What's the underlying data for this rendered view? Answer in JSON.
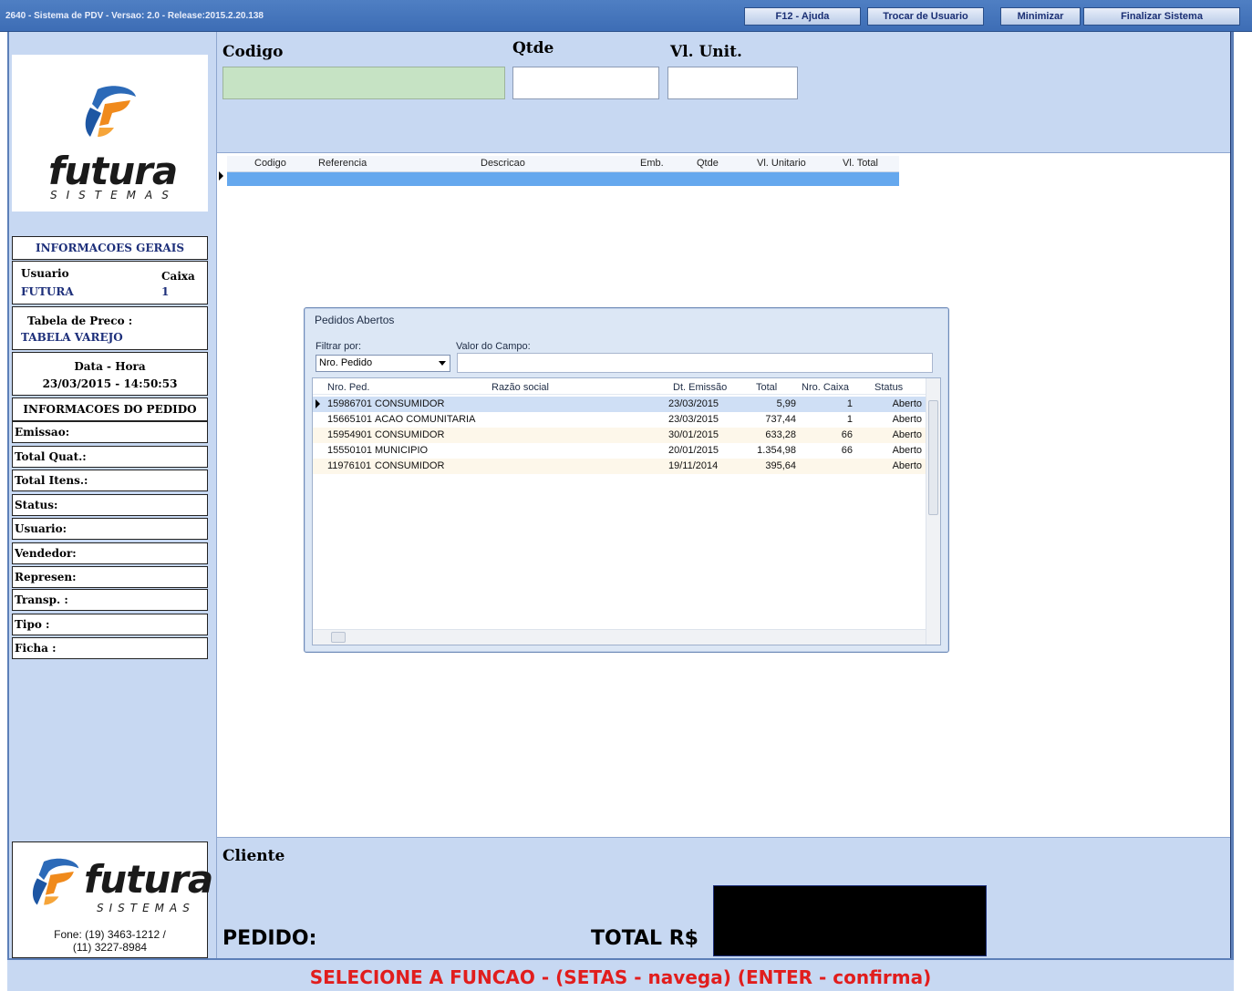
{
  "window": {
    "title": "2640 - Sistema de PDV - Versao: 2.0 - Release:2015.2.20.138",
    "buttons": {
      "help": "F12 - Ajuda",
      "switch_user": "Trocar de Usuario",
      "minimize": "Minimizar",
      "exit": "Finalizar Sistema"
    }
  },
  "brand": {
    "name": "futura",
    "sub": "SISTEMAS"
  },
  "info": {
    "header": "INFORMACOES GERAIS",
    "user_label": "Usuario",
    "user_value": "FUTURA",
    "caixa_label": "Caixa",
    "caixa_value": "1",
    "price_table_label": "Tabela de Preco :",
    "price_table_value": "TABELA VAREJO",
    "datetime_label": "Data - Hora",
    "datetime_value": "23/03/2015 - 14:50:53",
    "order_header": "INFORMACOES DO PEDIDO",
    "fields": [
      "Emissao:",
      "Total Quat.:",
      "Total Itens.:",
      "Status:",
      "Usuario:",
      "Vendedor:",
      "Represen:",
      "Transp. :",
      "Tipo :",
      "Ficha :"
    ]
  },
  "entry": {
    "codigo_label": "Codigo",
    "qtde_label": "Qtde",
    "vlunit_label": "Vl. Unit."
  },
  "grid": {
    "columns": [
      "Codigo",
      "Referencia",
      "Descricao",
      "Emb.",
      "Qtde",
      "Vl. Unitario",
      "Vl. Total"
    ]
  },
  "dialog": {
    "title": "Pedidos Abertos",
    "filter_label": "Filtrar por:",
    "filter_value": "Nro. Pedido",
    "field_value_label": "Valor do Campo:",
    "columns": [
      "Nro. Ped.",
      "Razão social",
      "Dt. Emissão",
      "Total",
      "Nro. Caixa",
      "Status"
    ],
    "rows": [
      {
        "nro": "15986701",
        "razao": "CONSUMIDOR",
        "data": "23/03/2015",
        "total": "5,99",
        "caixa": "1",
        "status": "Aberto"
      },
      {
        "nro": "15665101",
        "razao": "ACAO COMUNITARIA",
        "data": "23/03/2015",
        "total": "737,44",
        "caixa": "1",
        "status": "Aberto"
      },
      {
        "nro": "15954901",
        "razao": "CONSUMIDOR",
        "data": "30/01/2015",
        "total": "633,28",
        "caixa": "66",
        "status": "Aberto"
      },
      {
        "nro": "15550101",
        "razao": "MUNICIPIO",
        "data": "20/01/2015",
        "total": "1.354,98",
        "caixa": "66",
        "status": "Aberto"
      },
      {
        "nro": "11976101",
        "razao": "CONSUMIDOR",
        "data": "19/11/2014",
        "total": "395,64",
        "caixa": "",
        "status": "Aberto"
      }
    ]
  },
  "bottom": {
    "cliente_label": "Cliente",
    "pedido_label": "PEDIDO:",
    "total_label": "TOTAL R$",
    "phone": "Fone: (19) 3463-1212 /",
    "phone2": "(11) 3227-8984"
  },
  "status_message": "SELECIONE A FUNCAO - (SETAS - navega) (ENTER - confirma)",
  "colors": {
    "panel": "#c7d8f2",
    "titlebar": "#3d6db5",
    "selection": "#65a8ee",
    "status_text": "#e11d1d",
    "navy": "#1d2f7a"
  }
}
